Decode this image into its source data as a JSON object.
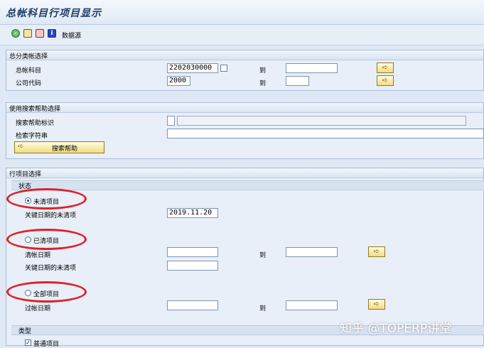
{
  "title": "总帐科目行项目显示",
  "toolbar": {
    "datasource_label": "数据源"
  },
  "sections": {
    "gl_selection": {
      "header": "总分类帐选择",
      "gl_account_label": "总帐科目",
      "gl_account_from": "2202030000",
      "gl_account_to": "",
      "company_code_label": "公司代码",
      "company_code_from": "2000",
      "company_code_to": "",
      "to_label": "到"
    },
    "search_help": {
      "header": "使用搜索帮助选择",
      "search_help_id_label": "搜索帮助标识",
      "search_string_label": "检索字符串",
      "search_help_button": "搜索帮助"
    },
    "item_selection": {
      "header": "行项目选择",
      "status_header": "状态",
      "open_items_label": "未清项目",
      "open_at_key_date_label": "关键日期的未清项",
      "open_key_date": "2019.11.20",
      "cleared_items_label": "已清项目",
      "clearing_date_label": "清帐日期",
      "cleared_open_at_key_date_label": "关键日期的未清项",
      "all_items_label": "全部项目",
      "posting_date_label": "过帐日期",
      "to_label": "到",
      "type_header": "类型",
      "normal_items_label": "普通项目"
    }
  },
  "watermark": "知乎 @TOPERP讲堂",
  "colors": {
    "highlight": "#e0202a",
    "background": "#dfe9f5"
  }
}
